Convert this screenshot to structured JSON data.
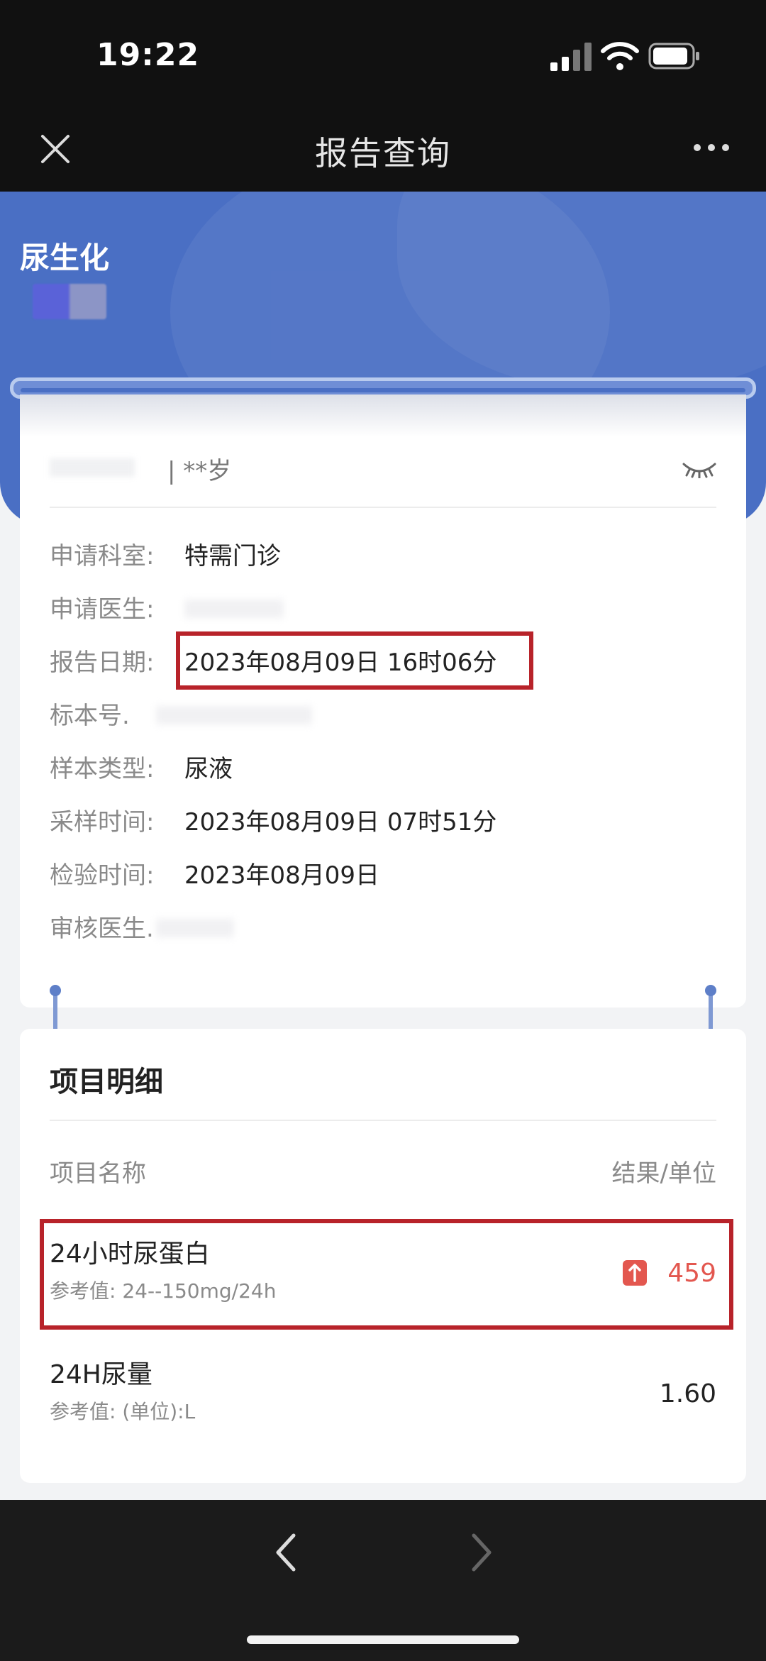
{
  "status_bar": {
    "time": "19:22"
  },
  "nav": {
    "title": "报告查询"
  },
  "header": {
    "report_title": "尿生化"
  },
  "patient": {
    "age": "| **岁"
  },
  "info": [
    {
      "label": "申请科室:",
      "value": "特需门诊"
    },
    {
      "label": "申请医生:",
      "value": ""
    },
    {
      "label": "报告日期:",
      "value": "2023年08月09日 16时06分"
    },
    {
      "label": "标本号.",
      "value": ""
    },
    {
      "label": "样本类型:",
      "value": "尿液"
    },
    {
      "label": "采样时间:",
      "value": "2023年08月09日 07时51分"
    },
    {
      "label": "检验时间:",
      "value": "2023年08月09日"
    },
    {
      "label": "审核医生.",
      "value": ""
    }
  ],
  "items_section": {
    "title": "项目明细",
    "col_name": "项目名称",
    "col_result": "结果/单位",
    "items": [
      {
        "name": "24小时尿蛋白",
        "reference": "参考值: 24--150mg/24h",
        "value": "459",
        "abnormal": true
      },
      {
        "name": "24H尿量",
        "reference": "参考值: (单位):L",
        "value": "1.60",
        "abnormal": false
      }
    ]
  },
  "colors": {
    "header_blue": "#4a6fc4",
    "abnormal_red": "#e3574f",
    "highlight_red": "#b8232a"
  }
}
